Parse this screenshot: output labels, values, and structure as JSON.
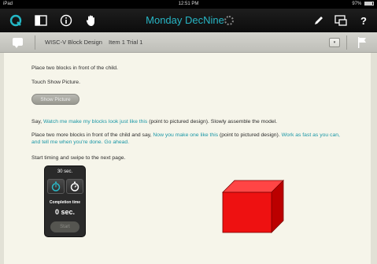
{
  "status_bar": {
    "device": "iPad",
    "time": "12:51 PM",
    "battery": "97%"
  },
  "toolbar": {
    "title": "Monday DecNine",
    "help_label": "?"
  },
  "item_bar": {
    "subtest": "WISC-V Block Design",
    "item": "Item 1 Trial 1",
    "dropdown_label": "▾"
  },
  "instructions": {
    "line1": "Place two blocks in front of the child.",
    "line2": "Touch Show Picture.",
    "show_picture_label": "Show Picture",
    "say1_pre": "Say, ",
    "say1_quote": "Watch me make my blocks look just like this",
    "say1_post": " (point to pictured design). Slowly assemble the model.",
    "say2_pre": "Place two more blocks in front of the child and say, ",
    "say2_quote1": "Now you make one like this",
    "say2_mid": " (point to pictured design). ",
    "say2_quote2": "Work as fast as you can, and tell me when you're done. Go ahead.",
    "line5": "Start timing and swipe to the next page."
  },
  "timer": {
    "limit": "30 sec.",
    "completion_label": "Completion time",
    "elapsed": "0 sec.",
    "start_label": "Start"
  },
  "colors": {
    "accent": "#27b5c4",
    "block_front": "#ee1111",
    "block_top": "#ff4545",
    "block_side": "#bb0000"
  }
}
